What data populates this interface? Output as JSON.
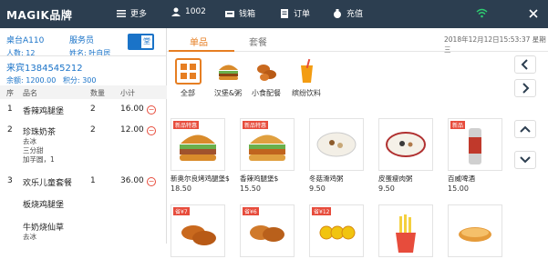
{
  "topbar": {
    "brand": "MAGIK品牌",
    "more": "更多",
    "user": "1002",
    "cashbox": "钱箱",
    "orders": "订单",
    "recharge": "充值"
  },
  "order": {
    "table": "桌台A110",
    "persons": "人数: 12",
    "waiter_label": "服务员",
    "waiter": "姓名: 叶自居",
    "toggle_label": "堂",
    "guest": "来宾1384545212",
    "balance": "余额: 1200.00",
    "points": "积分: 300",
    "columns": [
      "序",
      "品名",
      "数量",
      "小计"
    ],
    "items": [
      {
        "no": "1",
        "name": "香辣鸡腿堡",
        "qty": "2",
        "subtotal": "16.00",
        "notes": []
      },
      {
        "no": "2",
        "name": "珍珠奶茶",
        "qty": "2",
        "subtotal": "12.00",
        "notes": [
          "去冰",
          "三分甜",
          "加芋圆，1"
        ]
      },
      {
        "no": "3",
        "name": "欢乐儿童套餐",
        "qty": "1",
        "subtotal": "36.00",
        "notes": []
      },
      {
        "no": "",
        "name": "板烧鸡腿堡",
        "qty": "",
        "subtotal": "",
        "notes": []
      },
      {
        "no": "",
        "name": "牛奶烧仙草",
        "qty": "",
        "subtotal": "",
        "notes": [
          "去冰"
        ]
      }
    ]
  },
  "main": {
    "tabs": [
      "单品",
      "套餐"
    ],
    "datetime": "2018年12月12日15:53:37  星期三",
    "categories": [
      "全部",
      "汉堡&粥",
      "小食配餐",
      "缤纷饮料"
    ],
    "products": [
      {
        "name": "新奥尔良烤鸡腿堡$",
        "price": "18.50",
        "badge": "新品特惠"
      },
      {
        "name": "香辣鸡腿堡$",
        "price": "15.50",
        "badge": "新品特惠"
      },
      {
        "name": "冬菇滑鸡粥",
        "price": "9.50",
        "badge": ""
      },
      {
        "name": "皮蛋瘦肉粥",
        "price": "9.50",
        "badge": ""
      },
      {
        "name": "百威啤酒",
        "price": "15.00",
        "badge": "新品"
      },
      {
        "name": "",
        "price": "",
        "badge": "省¥7"
      },
      {
        "name": "",
        "price": "",
        "badge": "省¥6"
      },
      {
        "name": "",
        "price": "",
        "badge": "省¥12"
      },
      {
        "name": "",
        "price": "",
        "badge": ""
      },
      {
        "name": "",
        "price": "",
        "badge": ""
      }
    ]
  },
  "colors": {
    "topbar": "#2c3e50",
    "accent": "#e67e22",
    "blue": "#1a73c8",
    "minus": "#e74c3c"
  }
}
